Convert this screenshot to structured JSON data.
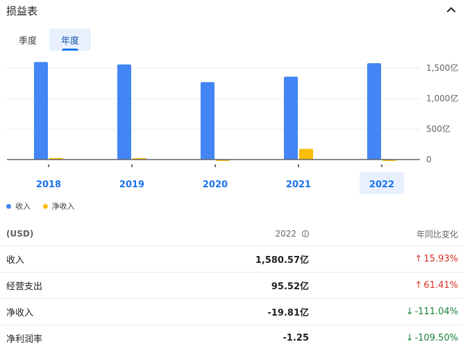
{
  "header": {
    "title": "损益表"
  },
  "tabs": [
    {
      "label": "季度",
      "active": false
    },
    {
      "label": "年度",
      "active": true
    }
  ],
  "chart_data": {
    "type": "bar",
    "categories": [
      "2018",
      "2019",
      "2020",
      "2021",
      "2022"
    ],
    "selected_category": "2022",
    "series": [
      {
        "name": "收入",
        "color": "#4285f4",
        "values": [
          1600,
          1560,
          1270,
          1360,
          1580.57
        ]
      },
      {
        "name": "净收入",
        "color": "#fbbc04",
        "values": [
          25,
          5,
          -15,
          175,
          -19.81
        ]
      }
    ],
    "y_ticks": [
      {
        "value": 1500,
        "label": "1,500亿"
      },
      {
        "value": 1000,
        "label": "1,000亿"
      },
      {
        "value": 500,
        "label": "500亿"
      },
      {
        "value": 0,
        "label": "0"
      }
    ],
    "ylim": [
      -30,
      1650
    ],
    "grid": true,
    "legend": "bottom-left"
  },
  "table": {
    "headers": {
      "label": "(USD)",
      "value": "2022",
      "change": "年同比变化"
    },
    "rows": [
      {
        "label": "收入",
        "value": "1,580.57亿",
        "arrow": "↑",
        "change": "15.93%",
        "direction": "up"
      },
      {
        "label": "经营支出",
        "value": "95.52亿",
        "arrow": "↑",
        "change": "61.41%",
        "direction": "up"
      },
      {
        "label": "净收入",
        "value": "-19.81亿",
        "arrow": "↓",
        "change": "-111.04%",
        "direction": "down"
      },
      {
        "label": "净利润率",
        "value": "-1.25",
        "arrow": "↓",
        "change": "-109.50%",
        "direction": "down"
      }
    ]
  }
}
